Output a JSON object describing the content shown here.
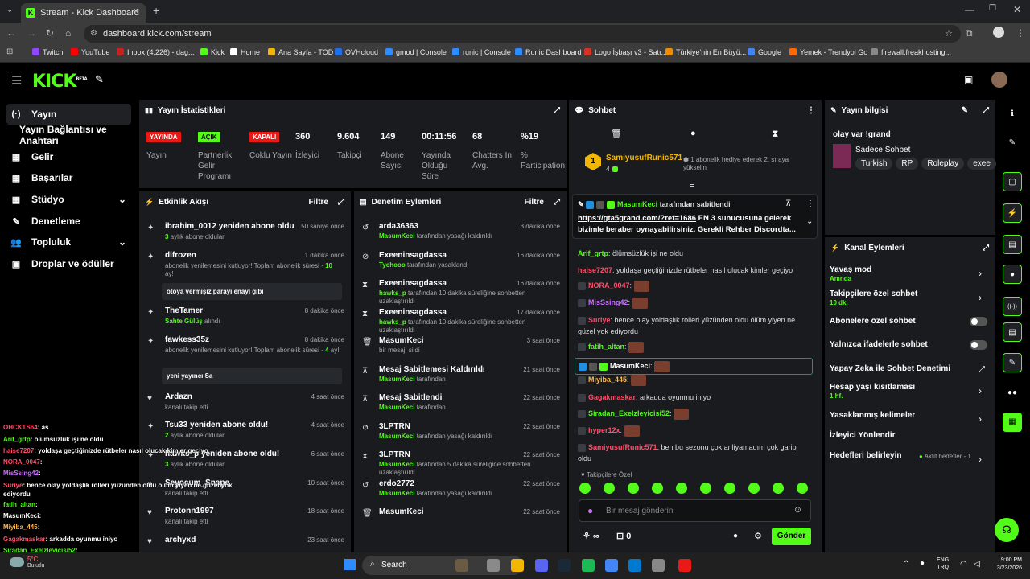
{
  "browser": {
    "tab_title": "Stream - Kick Dashboard",
    "url": "dashboard.kick.com/stream",
    "bookmarks": [
      "Twitch",
      "YouTube",
      "Inbox (4,226) - dag...",
      "Kick",
      "Home",
      "Ana Sayfa - TOD",
      "OVHcloud",
      "gmod | Console",
      "runic | Console",
      "Runic Dashboard",
      "Logo İşbaşı v3 - Satı...",
      "Türkiye'nin En Büyü...",
      "Google",
      "Yemek - Trendyol Go",
      "firewall.freakhosting..."
    ]
  },
  "header": {
    "logo": "KICK",
    "beta": "BETA"
  },
  "sidebar": {
    "items": [
      {
        "label": "Yayın",
        "icon": "(·)"
      },
      {
        "label": "Yayın Bağlantısı ve Anahtarı",
        "icon": ""
      },
      {
        "label": "Gelir",
        "icon": "▦"
      },
      {
        "label": "Başarılar",
        "icon": "▦"
      },
      {
        "label": "Stüdyo",
        "icon": "▦"
      },
      {
        "label": "Denetleme",
        "icon": "✎"
      },
      {
        "label": "Topluluk",
        "icon": "👥"
      },
      {
        "label": "Droplar ve ödüller",
        "icon": "▣"
      }
    ]
  },
  "stats": {
    "title": "Yayın İstatistikleri",
    "badges": [
      {
        "text": "YAYINDA",
        "label": "Yayın"
      },
      {
        "text": "AÇIK",
        "label": "Partnerlik Gelir Programı"
      },
      {
        "text": "KAPALI",
        "label": "Çoklu Yayın"
      }
    ],
    "metrics": [
      {
        "value": "360",
        "label": "İzleyici"
      },
      {
        "value": "9.604",
        "label": "Takipçi"
      },
      {
        "value": "149",
        "label": "Abone Sayısı"
      },
      {
        "value": "00:11:56",
        "label": "Yayında Olduğu Süre"
      },
      {
        "value": "68",
        "label": "Chatters In Avg."
      },
      {
        "value": "%19",
        "label": "% Participation"
      }
    ]
  },
  "activity": {
    "title": "Etkinlik Akışı",
    "filter": "Filtre",
    "items": [
      {
        "title": "ibrahim_0012 yeniden abone oldu!",
        "sub_g": "3",
        "sub": " aylık abone oldular",
        "time": "50 saniye önce",
        "icon": "✦"
      },
      {
        "title": "dlfrozen",
        "sub": "abonelik yenilemesini kutluyor! Toplam abonelik süresi - ",
        "sub_g": "10",
        "sub2": " ay!",
        "box": "otoya vermişiz parayı enayi gibi",
        "time": "1 dakika önce",
        "icon": "✦"
      },
      {
        "title": "TheTamer",
        "sub_g": "Sahte Gülüş",
        "sub": " alındı",
        "time": "8 dakika önce",
        "icon": "✦"
      },
      {
        "title": "fawkess35z",
        "sub": "abonelik yenilemesini kutluyor! Toplam abonelik süresi - ",
        "sub_g": "4",
        "sub2": " ay!",
        "box": "yeni yayıncı Sa",
        "time": "8 dakika önce",
        "icon": "✦"
      },
      {
        "title": "Ardazn",
        "sub": "kanalı takip etti",
        "time": "4 saat önce",
        "icon": "♥"
      },
      {
        "title": "Tsu33 yeniden abone oldu!",
        "sub_g": "2",
        "sub": " aylık abone oldular",
        "time": "4 saat önce",
        "icon": "✦"
      },
      {
        "title": "hawks_p yeniden abone oldu!",
        "sub_g": "3",
        "sub": " aylık abone oldular",
        "time": "6 saat önce",
        "icon": "✦"
      },
      {
        "title": "Seyocum_Snape",
        "sub": "kanalı takip etti",
        "time": "10 saat önce",
        "icon": "♥"
      },
      {
        "title": "Protonn1997",
        "sub": "kanalı takip etti",
        "time": "18 saat önce",
        "icon": "♥"
      },
      {
        "title": "archyxd",
        "sub": "",
        "time": "23 saat önce",
        "icon": "♥"
      }
    ]
  },
  "moderation": {
    "title": "Denetim Eylemleri",
    "filter": "Filtre",
    "items": [
      {
        "title": "arda36363",
        "mod": "MasumKeci",
        "sub": " tarafından yasağı kaldırıldı",
        "time": "3 dakika önce",
        "icon": "↺"
      },
      {
        "title": "Exeeninsagdassa",
        "mod": "Tychooo",
        "sub": " tarafından yasaklandı",
        "time": "16 dakika önce",
        "icon": "⊘"
      },
      {
        "title": "Exeeninsagdassa",
        "mod": "hawks_p",
        "sub": " tarafından 10 dakika süreliğine sohbetten uzaklaştırıldı",
        "time": "16 dakika önce",
        "icon": "⧗"
      },
      {
        "title": "Exeeninsagdassa",
        "mod": "hawks_p",
        "sub": " tarafından 10 dakika süreliğine sohbetten uzaklaştırıldı",
        "time": "17 dakika önce",
        "icon": "⧗"
      },
      {
        "title": "MasumKeci",
        "mod": "",
        "sub": "bir mesajı sildi",
        "time": "3 saat önce",
        "icon": "🗑"
      },
      {
        "title": "Mesaj Sabitlemesi Kaldırıldı",
        "mod": "MasumKeci",
        "sub": " tarafından",
        "time": "21 saat önce",
        "icon": "⊼"
      },
      {
        "title": "Mesaj Sabitlendi",
        "mod": "MasumKeci",
        "sub": " tarafından",
        "time": "22 saat önce",
        "icon": "⊼"
      },
      {
        "title": "3LPTRN",
        "mod": "MasumKeci",
        "sub": " tarafından yasağı kaldırıldı",
        "time": "22 saat önce",
        "icon": "↺"
      },
      {
        "title": "3LPTRN",
        "mod": "MasumKeci",
        "sub": " tarafından 5 dakika süreliğine sohbetten uzaklaştırıldı",
        "time": "22 saat önce",
        "icon": "⧗"
      },
      {
        "title": "erdo2772",
        "mod": "MasumKeci",
        "sub": " tarafından yasağı kaldırıldı",
        "time": "22 saat önce",
        "icon": "↺"
      },
      {
        "title": "MasumKeci",
        "mod": "",
        "sub": "",
        "time": "22 saat önce",
        "icon": "🗑"
      }
    ]
  },
  "chat": {
    "title": "Sohbet",
    "gift_user": "SamiyusufRunic571",
    "gift_count": "4",
    "gift_rank": "1",
    "gift_text": "1 abonelik hediye ederek 2. sıraya yükselin",
    "pinned_by": "MasumKeci",
    "pinned_suffix": " tarafından sabitlendi",
    "pinned_link": "https://gta5grand.com/?ref=1686",
    "pinned_text": " EN 3 sunucusuna gelerek bizimle beraber oynayabilirsiniz. Gerekli Rehber Discordta...",
    "messages": [
      {
        "user": "Arif_grtp",
        "color": "#53fc18",
        "text": ": ölümsüzlük işi ne oldu"
      },
      {
        "user": "haise7207",
        "color": "#ff4d6a",
        "text": ": yoldaşa geçtiğinizde rütbeler nasıl olucak kimler geçiyo"
      },
      {
        "user": "NORA_0047",
        "color": "#ff4d6a",
        "text": ":",
        "emote": true
      },
      {
        "user": "MisSsing42",
        "color": "#c86bff",
        "text": ":",
        "emote": true
      },
      {
        "user": "Suriye",
        "color": "#ff4d6a",
        "text": ": bence olay yoldaşlık rolleri yüzünden oldu ölüm yiyen ne güzel yok ediyordu"
      },
      {
        "user": "fatih_altan",
        "color": "#53fc18",
        "text": ":",
        "emote": true
      },
      {
        "user": "MasumKeci",
        "color": "#fff",
        "text": ":",
        "emote": true
      },
      {
        "user": "Miyiba_445",
        "color": "#ffb84d",
        "text": ":",
        "emote": true
      },
      {
        "user": "Gagakmaskar",
        "color": "#ff4d6a",
        "text": ": arkadda oyunmu iniyo"
      },
      {
        "user": "Siradan_Exelzleyicisi52",
        "color": "#53fc18",
        "text": ":",
        "emote": true
      },
      {
        "user": "hyper12x",
        "color": "#ff4d6a",
        "text": ":",
        "emote": true
      },
      {
        "user": "SamiyusufRunic571",
        "color": "#ff4d6a",
        "text": ": ben bu sezonu çok anliyamadım çok garip oldu"
      }
    ],
    "followers_only": "Takipçilere Özel",
    "placeholder": "Bir mesaj gönderin",
    "points": "∞",
    "gifts": "0",
    "send": "Gönder"
  },
  "stream_info": {
    "title": "Yayın bilgisi",
    "stream_title": "olay var !grand",
    "category": "Sadece Sohbet",
    "tags": [
      "Turkish",
      "RP",
      "Roleplay",
      "exee"
    ]
  },
  "channel_actions": {
    "title": "Kanal Eylemleri",
    "items": [
      {
        "label": "Yavaş mod",
        "sub": "Anında",
        "type": "chevron"
      },
      {
        "label": "Takipçilere özel sohbet",
        "sub": "10 dk.",
        "type": "chevron"
      },
      {
        "label": "Abonelere özel sohbet",
        "sub": "",
        "type": "toggle"
      },
      {
        "label": "Yalnızca ifadelerle sohbet",
        "sub": "",
        "type": "toggle"
      },
      {
        "label": "Yapay Zeka ile Sohbet Denetimi",
        "sub": "",
        "type": "external"
      },
      {
        "label": "Hesap yaşı kısıtlaması",
        "sub": "1 hf.",
        "type": "chevron"
      },
      {
        "label": "Yasaklanmış kelimeler",
        "sub": "",
        "type": "chevron"
      },
      {
        "label": "İzleyici Yönlendir",
        "sub": "",
        "type": "none"
      },
      {
        "label": "Hedefleri belirleyin",
        "sub": "",
        "type": "chevron",
        "extra": "Aktif hedefler - 1"
      }
    ]
  },
  "overlay_chat": [
    {
      "user": "OHCKTS64",
      "color": "#ff4d6a",
      "text": ": as"
    },
    {
      "user": "Arif_grtp",
      "color": "#53fc18",
      "text": ": ölümsüzlük işi ne oldu"
    },
    {
      "user": "haise7207",
      "color": "#ff4d6a",
      "text": ": yoldaşa geçtiğinizde rütbeler nasıl olucak kimler geçiyo"
    },
    {
      "user": "NORA_0047",
      "color": "#ff4d6a",
      "text": ":"
    },
    {
      "user": "MisSsing42",
      "color": "#c86bff",
      "text": ":"
    },
    {
      "user": "Suriye",
      "color": "#ff4d6a",
      "text": ": bence olay yoldaşlık rolleri yüzünden oldu ölüm yiyen ne güzel yok ediyordu"
    },
    {
      "user": "fatih_altan",
      "color": "#53fc18",
      "text": ":"
    },
    {
      "user": "MasumKeci",
      "color": "#fff",
      "text": ":"
    },
    {
      "user": "Miyiba_445",
      "color": "#ffb84d",
      "text": ":"
    },
    {
      "user": "Gagakmaskar",
      "color": "#ff4d6a",
      "text": ": arkadda oyunmu iniyo"
    },
    {
      "user": "Siradan_Exelzleyicisi52",
      "color": "#53fc18",
      "text": ":"
    },
    {
      "user": "hyper12x",
      "color": "#ff4d6a",
      "text": ":"
    },
    {
      "user": "SamiyusufRunic571",
      "color": "#ff4d6a",
      "text": ": ben bu sezonu çok anliyamadım çok garip oldu"
    }
  ],
  "taskbar": {
    "weather_temp": "5°C",
    "weather_text": "Bulutlu",
    "search": "Search",
    "lang1": "ENG",
    "lang2": "TRQ",
    "time": "9:00 PM",
    "date": "3/23/2026"
  }
}
